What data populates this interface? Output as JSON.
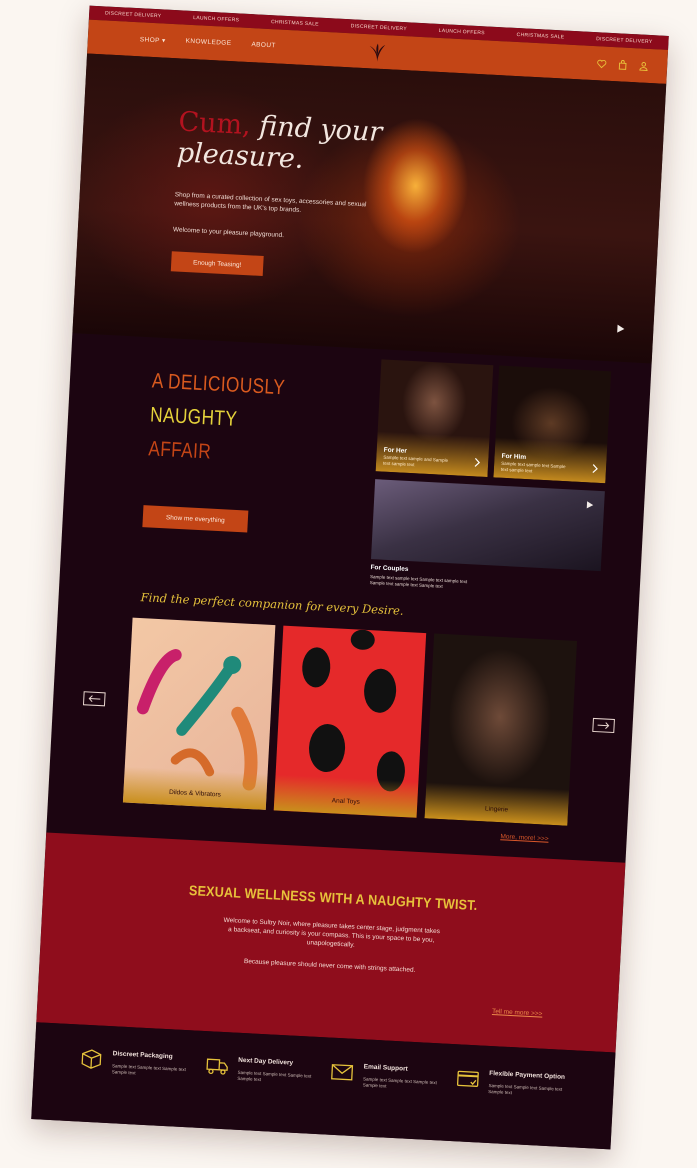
{
  "ticker": [
    "DISCREET DELIVERY",
    "LAUNCH OFFERS",
    "CHRISTMAS SALE",
    "DISCREET DELIVERY",
    "LAUNCH OFFERS",
    "CHRISTMAS SALE",
    "DISCREET DELIVERY"
  ],
  "nav": {
    "shop": "SHOP",
    "knowledge": "KNOWLEDGE",
    "about": "ABOUT"
  },
  "hero": {
    "title_accent": "Cum,",
    "title_rest": " find your",
    "title_line2": "pleasure.",
    "subtitle": "Shop from a curated collection of sex toys, accessories and sexual wellness products from the UK's top brands.",
    "welcome": "Welcome to your pleasure playground.",
    "cta": "Enough Teasing!"
  },
  "affair": {
    "line1": "A DELICIOUSLY",
    "line2": "NAUGHTY",
    "line3": "AFFAIR",
    "cta": "Show me everything",
    "cards": {
      "her": {
        "title": "For Her",
        "desc": "Sample text sample and Sample text sample text"
      },
      "him": {
        "title": "For Him",
        "desc": "Sample text sample text Sample text sample text"
      },
      "couples": {
        "title": "For Couples",
        "desc": "Sample text sample text Sample text sample text Sample text sample text Sample text"
      }
    }
  },
  "companion": {
    "title": "Find the perfect companion for every Desire.",
    "products": [
      "Dildos & Vibrators",
      "Anal Toys",
      "Lingerie"
    ],
    "more": "More, more! >>>"
  },
  "wellness": {
    "title": "SEXUAL WELLNESS WITH A NAUGHTY TWIST.",
    "text": "Welcome to Sultry Noir, where pleasure takes center stage, judgment takes a backseat, and curiosity is your compass. This is your space to be you, unapologetically.",
    "text2": "Because pleasure should never come with strings attached.",
    "cta": "Tell me more >>>"
  },
  "features": [
    {
      "title": "Discreet Packaging",
      "desc": "Sample text Sample text Sample text Sample text",
      "icon": "box-icon"
    },
    {
      "title": "Next Day Delivery",
      "desc": "Sample text Sample text Sample text Sample text",
      "icon": "truck-icon"
    },
    {
      "title": "Email Support",
      "desc": "Sample text Sample text Sample text Sample text",
      "icon": "mail-icon"
    },
    {
      "title": "Flexible Payment Option",
      "desc": "Sample text Sample text Sample text Sample text",
      "icon": "card-icon"
    }
  ],
  "colors": {
    "accent": "#c34516",
    "dark": "#1c0511",
    "crimson": "#8f0d1c",
    "gold": "#e5c23b"
  }
}
